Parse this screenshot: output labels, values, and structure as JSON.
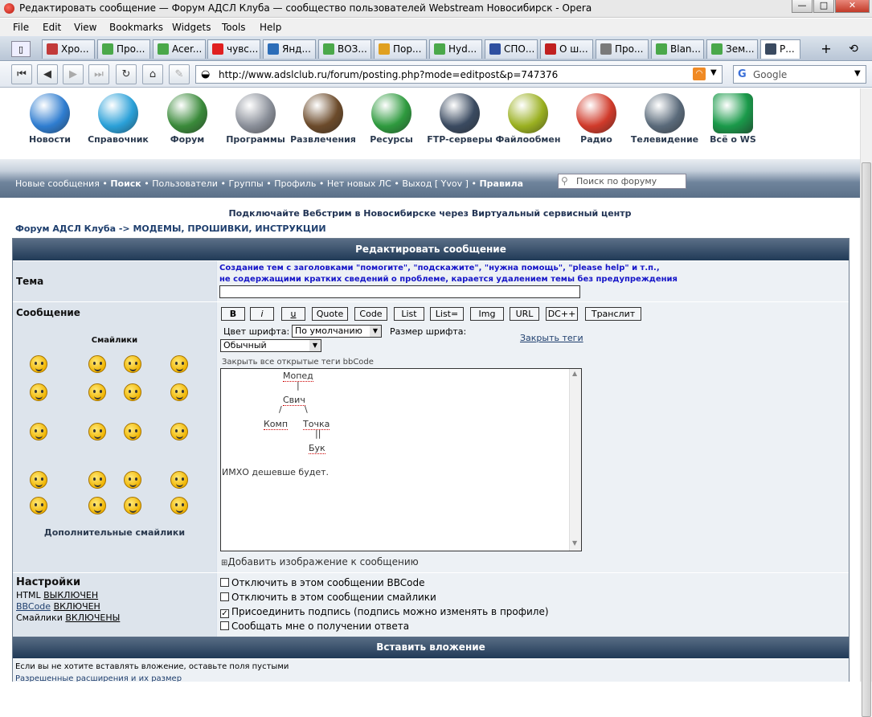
{
  "window": {
    "title": "Редактировать сообщение — Форум АДСЛ Клуба — сообщество пользователей Webstream Новосибирск - Opera",
    "min_glyph": "—",
    "max_glyph": "□",
    "close_glyph": "✕"
  },
  "menu": [
    "File",
    "Edit",
    "View",
    "Bookmarks",
    "Widgets",
    "Tools",
    "Help"
  ],
  "tabs": [
    {
      "label": "Хро...",
      "color": "#c23a3a"
    },
    {
      "label": "Про...",
      "color": "#4aa84a"
    },
    {
      "label": "Acer...",
      "color": "#4aa84a"
    },
    {
      "label": "чувс...",
      "color": "#e02020"
    },
    {
      "label": "Янд...",
      "color": "#2c6db8"
    },
    {
      "label": "ВОЗ...",
      "color": "#4aa84a"
    },
    {
      "label": "Пор...",
      "color": "#e0a020"
    },
    {
      "label": "Hyd...",
      "color": "#4aa84a"
    },
    {
      "label": "СПО...",
      "color": "#3050a0"
    },
    {
      "label": "О ш...",
      "color": "#c02020"
    },
    {
      "label": "Про...",
      "color": "#7a7a7a"
    },
    {
      "label": "Blan...",
      "color": "#4aa84a"
    },
    {
      "label": "Зем...",
      "color": "#4aa84a"
    },
    {
      "label": "Р...",
      "color": "#3a4a60"
    }
  ],
  "address": {
    "url": "http://www.adslclub.ru/forum/posting.php?mode=editpost&p=747376",
    "search_placeholder": "Google"
  },
  "top_icons": [
    {
      "label": "Новости",
      "color": "#2f7dd0"
    },
    {
      "label": "Справочник",
      "color": "#2aa0d8"
    },
    {
      "label": "Форум",
      "color": "#3a8a3a"
    },
    {
      "label": "Программы",
      "color": "#8a8f99"
    },
    {
      "label": "Развлечения",
      "color": "#6b4a2a"
    },
    {
      "label": "Ресурсы",
      "color": "#2e9a3e"
    },
    {
      "label": "FTP-серверы",
      "color": "#3a4a60"
    },
    {
      "label": "Файлообмен",
      "color": "#9ab020"
    },
    {
      "label": "Радио",
      "color": "#d03a2a"
    },
    {
      "label": "Телевидение",
      "color": "#5a6a7a"
    },
    {
      "label": "Всё о WS",
      "color": "#1a9a4a"
    }
  ],
  "nav": {
    "new_posts": "Новые сообщения",
    "search": "Поиск",
    "users": "Пользователи",
    "groups": "Группы",
    "profile": "Профиль",
    "no_pm": "Нет новых ЛС",
    "logout": "Выход [ Yvov ]",
    "rules": "Правила",
    "sep": "•",
    "forum_search_placeholder": "Поиск по форуму"
  },
  "promo": "Подключайте Вебстрим в Новосибирске через Виртуальный сервисный центр",
  "breadcrumb": "Форум АДСЛ Клуба -> МОДЕМЫ, ПРОШИВКИ, ИНСТРУКЦИИ",
  "form": {
    "header": "Редактировать сообщение",
    "topic_label": "Тема",
    "topic_warning_1": "Создание тем с заголовками \"помогите\", \"подскажите\", \"нужна помощь\", \"please help\" и т.п.,",
    "topic_warning_2": "не содержащими кратких сведений о проблеме, карается удалением темы без предупреждения",
    "message_label": "Сообщение",
    "smilies_title": "Смайлики",
    "more_smilies": "Дополнительные смайлики",
    "bbcode_buttons": [
      "B",
      "i",
      "u",
      "Quote",
      "Code",
      "List",
      "List=",
      "Img",
      "URL",
      "DC++",
      "Транслит"
    ],
    "font_color_label": "Цвет шрифта:",
    "font_color_value": "По умолчанию",
    "font_size_label": "Размер шрифта:",
    "font_size_value": "Обычный",
    "close_tags": "Закрыть теги",
    "close_all_tags": "Закрыть все открытые теги bbCode",
    "message_tree": [
      "Мопед",
      "|",
      "Свич",
      "/",
      "\\",
      "Комп",
      "Точка",
      "||",
      "Бук"
    ],
    "message_line": "ИМХО дешевше будет.",
    "add_image": "Добавить изображение к сообщению",
    "settings_label": "Настройки",
    "html_label": "HTML",
    "html_state": "ВЫКЛЮЧЕН",
    "bbcode_label": "BBCode",
    "bbcode_state": "ВКЛЮЧЕН",
    "smilies_label": "Смайлики",
    "smilies_state": "ВКЛЮЧЕНЫ",
    "options": [
      {
        "label": "Отключить в этом сообщении BBCode",
        "checked": false
      },
      {
        "label": "Отключить в этом сообщении смайлики",
        "checked": false
      },
      {
        "label": "Присоединить подпись (подпись можно изменять в профиле)",
        "checked": true
      },
      {
        "label": "Сообщать мне о получении ответа",
        "checked": false
      }
    ],
    "attach_header": "Вставить вложение",
    "attach_note": "Если вы не хотите вставлять вложение, оставьте поля пустыми",
    "attach_cut": "Разрешенные расширения и их размер"
  }
}
